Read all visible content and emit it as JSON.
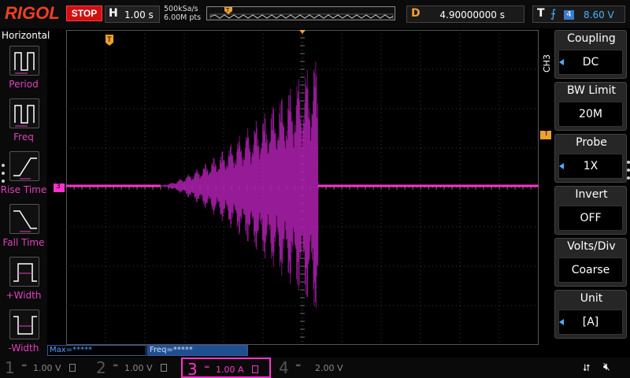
{
  "brand": "RIGOL",
  "run_state": "STOP",
  "horizontal": {
    "label": "H",
    "timebase": "1.00 s",
    "sample_rate": "500kSa/s",
    "memory_depth": "6.00M pts"
  },
  "delay": {
    "label": "D",
    "value": "4.90000000 s"
  },
  "trigger": {
    "label": "T",
    "edge_icon": "rising-edge-icon",
    "source": "4",
    "level": "8.60 V"
  },
  "left_menu": {
    "title": "Horizontal",
    "items": [
      {
        "label": "Period",
        "icon": "period-icon"
      },
      {
        "label": "Freq",
        "icon": "freq-icon"
      },
      {
        "label": "Rise Time",
        "icon": "rise-time-icon"
      },
      {
        "label": "Fall Time",
        "icon": "fall-time-icon"
      },
      {
        "label": "+Width",
        "icon": "pos-width-icon"
      },
      {
        "label": "-Width",
        "icon": "neg-width-icon"
      }
    ]
  },
  "channel_menu": {
    "channel": "CH3",
    "items": [
      {
        "title": "Coupling",
        "value": "DC",
        "has_arrow": true
      },
      {
        "title": "BW Limit",
        "value": "20M",
        "has_arrow": false
      },
      {
        "title": "Probe",
        "value": "1X",
        "has_arrow": true
      },
      {
        "title": "Invert",
        "value": "OFF",
        "has_arrow": false
      },
      {
        "title": "Volts/Div",
        "value": "Coarse",
        "has_arrow": false
      },
      {
        "title": "Unit",
        "value": "[A]",
        "has_arrow": true
      }
    ]
  },
  "markers": {
    "trigger_pos": "T",
    "ch3_ground": "3"
  },
  "measurements": [
    {
      "label": "Max=*****",
      "active": false
    },
    {
      "label": "Freq=*****",
      "active": true
    }
  ],
  "channels": [
    {
      "num": "1",
      "coupling": "DC",
      "scale": "1.00 V",
      "active": false
    },
    {
      "num": "2",
      "coupling": "DC",
      "scale": "1.00 V",
      "active": false
    },
    {
      "num": "3",
      "coupling": "DC",
      "scale": "1.00 A",
      "active": true
    },
    {
      "num": "4",
      "coupling": "DC",
      "scale": "2.00 V",
      "active": false
    }
  ],
  "colors": {
    "ch3": "#ff33cc",
    "waveform": "#b020b0",
    "trigger": "#f0a030",
    "accent_blue": "#4ab0ff"
  }
}
